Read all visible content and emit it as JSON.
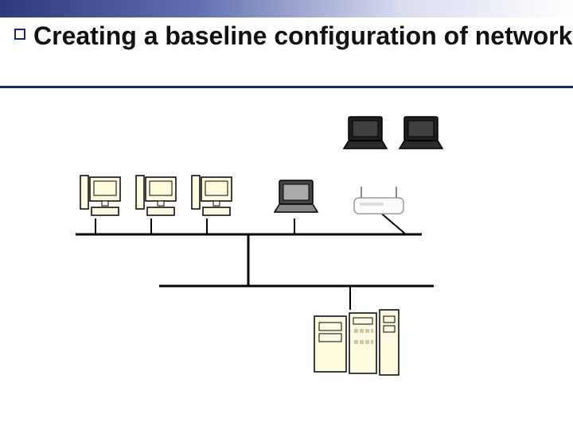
{
  "slide": {
    "title": "Creating a baseline configuration of network"
  },
  "diagram": {
    "devices": {
      "workstations": 3,
      "laptops_wired_gray": 1,
      "laptops_wireless_dark": 2,
      "wireless_router": 1,
      "servers": 3
    },
    "topology": "Three beige workstations and one gray laptop connect to an upper horizontal bus; a white wireless router also connects to that bus and serves two dark wireless laptops above. The upper bus drops to a lower horizontal bus, which connects to a cluster of three beige servers."
  }
}
